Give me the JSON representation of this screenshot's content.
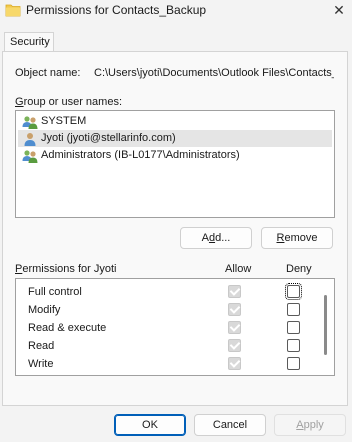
{
  "window": {
    "title": "Permissions for Contacts_Backup",
    "icon": "folder-icon",
    "close_glyph": "✕"
  },
  "tabs": [
    {
      "label": "Security",
      "selected": true
    }
  ],
  "object_name": {
    "label": "Object name:",
    "value": "C:\\Users\\jyoti\\Documents\\Outlook Files\\Contacts_"
  },
  "group_list": {
    "label_prefix": "G",
    "label_rest": "roup or user names:",
    "items": [
      {
        "name": "SYSTEM",
        "icon": "users-group-icon",
        "selected": false
      },
      {
        "name": "Jyoti (jyoti@stellarinfo.com)",
        "icon": "user-icon",
        "selected": true
      },
      {
        "name": "Administrators (IB-L0177\\Administrators)",
        "icon": "users-group-icon",
        "selected": false
      }
    ]
  },
  "buttons": {
    "add_prefix": "A",
    "add_underline": "d",
    "add_suffix": "d...",
    "remove_underline": "R",
    "remove_suffix": "emove",
    "ok": "OK",
    "cancel": "Cancel",
    "apply_underline": "A",
    "apply_suffix": "pply"
  },
  "permissions": {
    "label_prefix": "P",
    "label_rest": "ermissions for Jyoti",
    "allow_header": "Allow",
    "deny_header": "Deny",
    "rows": [
      {
        "name": "Full control",
        "allow": true,
        "deny": false
      },
      {
        "name": "Modify",
        "allow": true,
        "deny": false
      },
      {
        "name": "Read & execute",
        "allow": true,
        "deny": false
      },
      {
        "name": "Read",
        "allow": true,
        "deny": false
      },
      {
        "name": "Write",
        "allow": true,
        "deny": false
      },
      {
        "name": "",
        "allow": true,
        "deny": false
      }
    ]
  },
  "colors": {
    "accent": "#005fb8",
    "dialog_bg": "#f3f3f3",
    "panel_bg": "#f9f9f9",
    "selected_row": "#e5e5e5"
  }
}
